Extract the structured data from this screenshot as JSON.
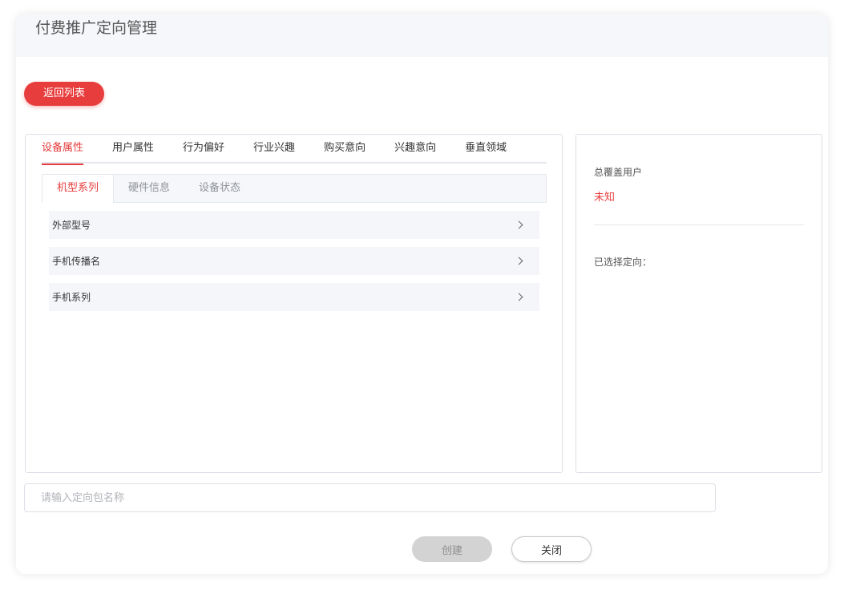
{
  "header": {
    "title": "付费推广定向管理"
  },
  "toolbar": {
    "back_label": "返回列表"
  },
  "tabs": [
    {
      "label": "设备属性",
      "active": true
    },
    {
      "label": "用户属性",
      "active": false
    },
    {
      "label": "行为偏好",
      "active": false
    },
    {
      "label": "行业兴趣",
      "active": false
    },
    {
      "label": "购买意向",
      "active": false
    },
    {
      "label": "兴趣意向",
      "active": false
    },
    {
      "label": "垂直领域",
      "active": false
    }
  ],
  "subtabs": [
    {
      "label": "机型系列",
      "active": true
    },
    {
      "label": "硬件信息",
      "active": false
    },
    {
      "label": "设备状态",
      "active": false
    }
  ],
  "list_items": [
    {
      "label": "外部型号",
      "icon": "chevron-right-icon"
    },
    {
      "label": "手机传播名",
      "icon": "chevron-right-icon"
    },
    {
      "label": "手机系列",
      "icon": "chevron-right-icon"
    }
  ],
  "summary": {
    "coverage_label": "总覆盖用户",
    "coverage_value": "未知",
    "selected_label": "已选择定向："
  },
  "form": {
    "name_placeholder": "请输入定向包名称",
    "name_value": ""
  },
  "actions": {
    "create_label": "创建",
    "close_label": "关闭"
  },
  "colors": {
    "accent": "#e83d3d",
    "panel_bg": "#f5f7fa",
    "disabled_button": "#d3d3d3"
  }
}
